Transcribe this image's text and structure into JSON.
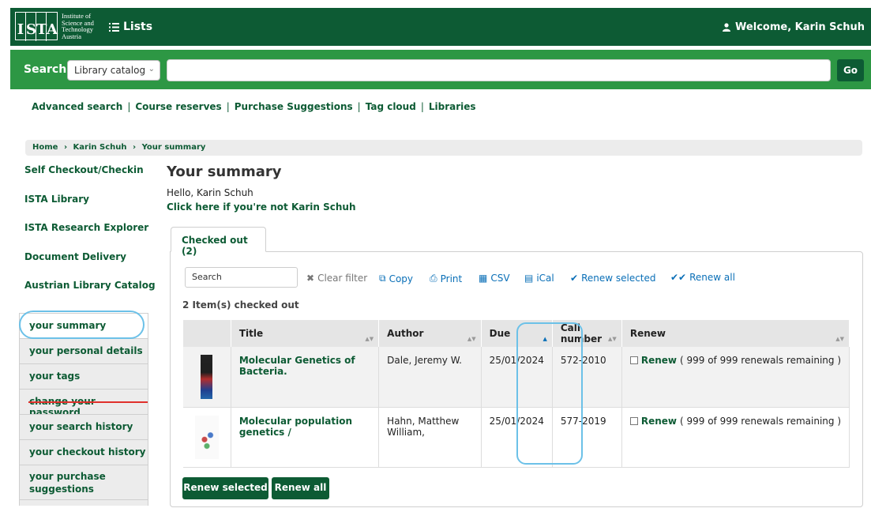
{
  "header": {
    "logo_letters": [
      "I",
      "S",
      "T",
      "A"
    ],
    "logo_lines": [
      "Institute of",
      "Science and",
      "Technology",
      "Austria"
    ],
    "lists_label": "Lists",
    "welcome_label": "Welcome, Karin Schuh"
  },
  "search": {
    "label": "Search",
    "scope_selected": "Library catalog",
    "query": "",
    "go_label": "Go"
  },
  "navlinks": [
    "Advanced search",
    "Course reserves",
    "Purchase Suggestions",
    "Tag cloud",
    "Libraries"
  ],
  "breadcrumb": [
    "Home",
    "Karin Schuh",
    "Your summary"
  ],
  "sidebar": {
    "links": [
      "Self Checkout/Checkin",
      "ISTA Library",
      "ISTA Research Explorer",
      "Document Delivery",
      "Austrian Library Catalog"
    ],
    "menu": [
      "your summary",
      "your personal details",
      "your tags",
      "change your password",
      "your search history",
      "your checkout history",
      "your purchase suggestions"
    ]
  },
  "main": {
    "title": "Your summary",
    "hello": "Hello, Karin Schuh",
    "not_you": "Click here if you're not Karin Schuh",
    "tab_label": "Checked out (2)",
    "filter_placeholder": "Search",
    "toolbar": {
      "clear_filter": "Clear filter",
      "copy": "Copy",
      "print": "Print",
      "csv": "CSV",
      "ical": "iCal",
      "renew_selected": "Renew selected",
      "renew_all": "Renew all"
    },
    "items_count": "2 Item(s) checked out",
    "columns": [
      "Title",
      "Author",
      "Due",
      "Call number",
      "Renew"
    ],
    "rows": [
      {
        "title": "Molecular Genetics of Bacteria.",
        "author": "Dale, Jeremy W.",
        "due": "25/01/2024",
        "call_number": "572-2010",
        "renew_link": "Renew",
        "renew_note": "( 999 of 999 renewals remaining )"
      },
      {
        "title": "Molecular population genetics /",
        "author": "Hahn, Matthew William,",
        "due": "25/01/2024",
        "call_number": "577-2019",
        "renew_link": "Renew",
        "renew_note": "( 999 of 999 renewals remaining )"
      }
    ],
    "buttons": {
      "renew_selected": "Renew selected",
      "renew_all": "Renew all"
    }
  }
}
